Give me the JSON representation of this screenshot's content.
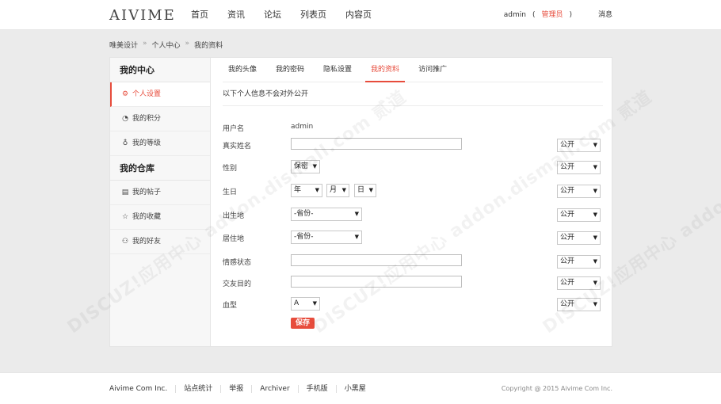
{
  "header": {
    "logo": "AIVIME",
    "nav": [
      "首页",
      "资讯",
      "论坛",
      "列表页",
      "内容页"
    ],
    "username": "admin",
    "role_open": "(",
    "role": "管理员",
    "role_close": ")",
    "messages": "消息"
  },
  "breadcrumb": [
    "唯美设计",
    "个人中心",
    "我的资料"
  ],
  "sidebar": {
    "section1_title": "我的中心",
    "section1_items": [
      {
        "label": "个人设置",
        "icon": "gear-icon",
        "active": true
      },
      {
        "label": "我的积分",
        "icon": "piggy-bank-icon"
      },
      {
        "label": "我的等级",
        "icon": "trophy-icon"
      }
    ],
    "section2_title": "我的仓库",
    "section2_items": [
      {
        "label": "我的帖子",
        "icon": "document-icon"
      },
      {
        "label": "我的收藏",
        "icon": "star-icon"
      },
      {
        "label": "我的好友",
        "icon": "friends-icon"
      }
    ]
  },
  "tabs": [
    "我的头像",
    "我的密码",
    "隐私设置",
    "我的资料",
    "访问推广"
  ],
  "active_tab": "我的资料",
  "notice": "以下个人信息不会对外公开",
  "form": {
    "username_label": "用户名",
    "username_value": "admin",
    "realname_label": "真实姓名",
    "gender_label": "性别",
    "gender_value": "保密",
    "birthday_label": "生日",
    "birth_year": "年",
    "birth_month": "月",
    "birth_day": "日",
    "birthplace_label": "出生地",
    "birthplace_value": "-省份-",
    "residence_label": "居住地",
    "residence_value": "-省份-",
    "emotion_label": "情感状态",
    "purpose_label": "交友目的",
    "blood_label": "血型",
    "blood_value": "A",
    "privacy_value": "公开",
    "save_label": "保存"
  },
  "watermark": "DISCUZ!应用中心 addon.dismall.com 贰道",
  "footer": {
    "links": [
      "Aivime Com Inc.",
      "站点统计",
      "举报",
      "Archiver",
      "手机版",
      "小黑屋"
    ],
    "copyright": "Copyright @ 2015 Aivime Com Inc."
  }
}
